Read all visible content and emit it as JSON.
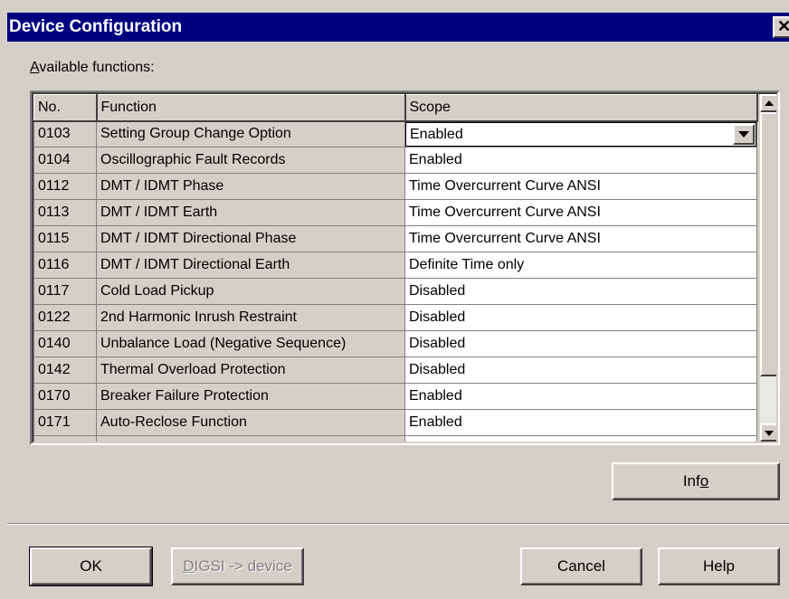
{
  "window": {
    "title": "Device Configuration",
    "close_glyph": "✕"
  },
  "available_label": {
    "accel": "A",
    "rest": "vailable functions:"
  },
  "grid": {
    "headers": {
      "no": "No.",
      "function": "Function",
      "scope": "Scope"
    },
    "rows": [
      {
        "no": "0103",
        "function": "Setting Group Change Option",
        "scope": "Enabled",
        "dropdown": true
      },
      {
        "no": "0104",
        "function": "Oscillographic Fault Records",
        "scope": "Enabled"
      },
      {
        "no": "0112",
        "function": "DMT / IDMT Phase",
        "scope": "Time Overcurrent Curve  ANSI"
      },
      {
        "no": "0113",
        "function": "DMT / IDMT Earth",
        "scope": "Time Overcurrent Curve  ANSI"
      },
      {
        "no": "0115",
        "function": "DMT / IDMT Directional Phase",
        "scope": "Time Overcurrent Curve  ANSI"
      },
      {
        "no": "0116",
        "function": "DMT / IDMT Directional Earth",
        "scope": "Definite Time only"
      },
      {
        "no": "0117",
        "function": "Cold Load Pickup",
        "scope": "Disabled"
      },
      {
        "no": "0122",
        "function": "2nd Harmonic Inrush Restraint",
        "scope": "Disabled"
      },
      {
        "no": "0140",
        "function": "Unbalance Load (Negative Sequence)",
        "scope": "Disabled"
      },
      {
        "no": "0142",
        "function": "Thermal Overload Protection",
        "scope": "Disabled"
      },
      {
        "no": "0170",
        "function": "Breaker Failure Protection",
        "scope": "Enabled"
      },
      {
        "no": "0171",
        "function": "Auto-Reclose Function",
        "scope": "Enabled"
      }
    ]
  },
  "buttons": {
    "info": {
      "pre": "Inf",
      "accel": "o",
      "post": ""
    },
    "ok": "OK",
    "digsi": {
      "accel": "D",
      "rest": "IGSI -> device"
    },
    "cancel": "Cancel",
    "help": "Help"
  },
  "icons": {
    "close": "close-icon",
    "dropdown": "chevron-down-icon",
    "scroll_up": "arrow-up-icon",
    "scroll_down": "arrow-down-icon"
  }
}
